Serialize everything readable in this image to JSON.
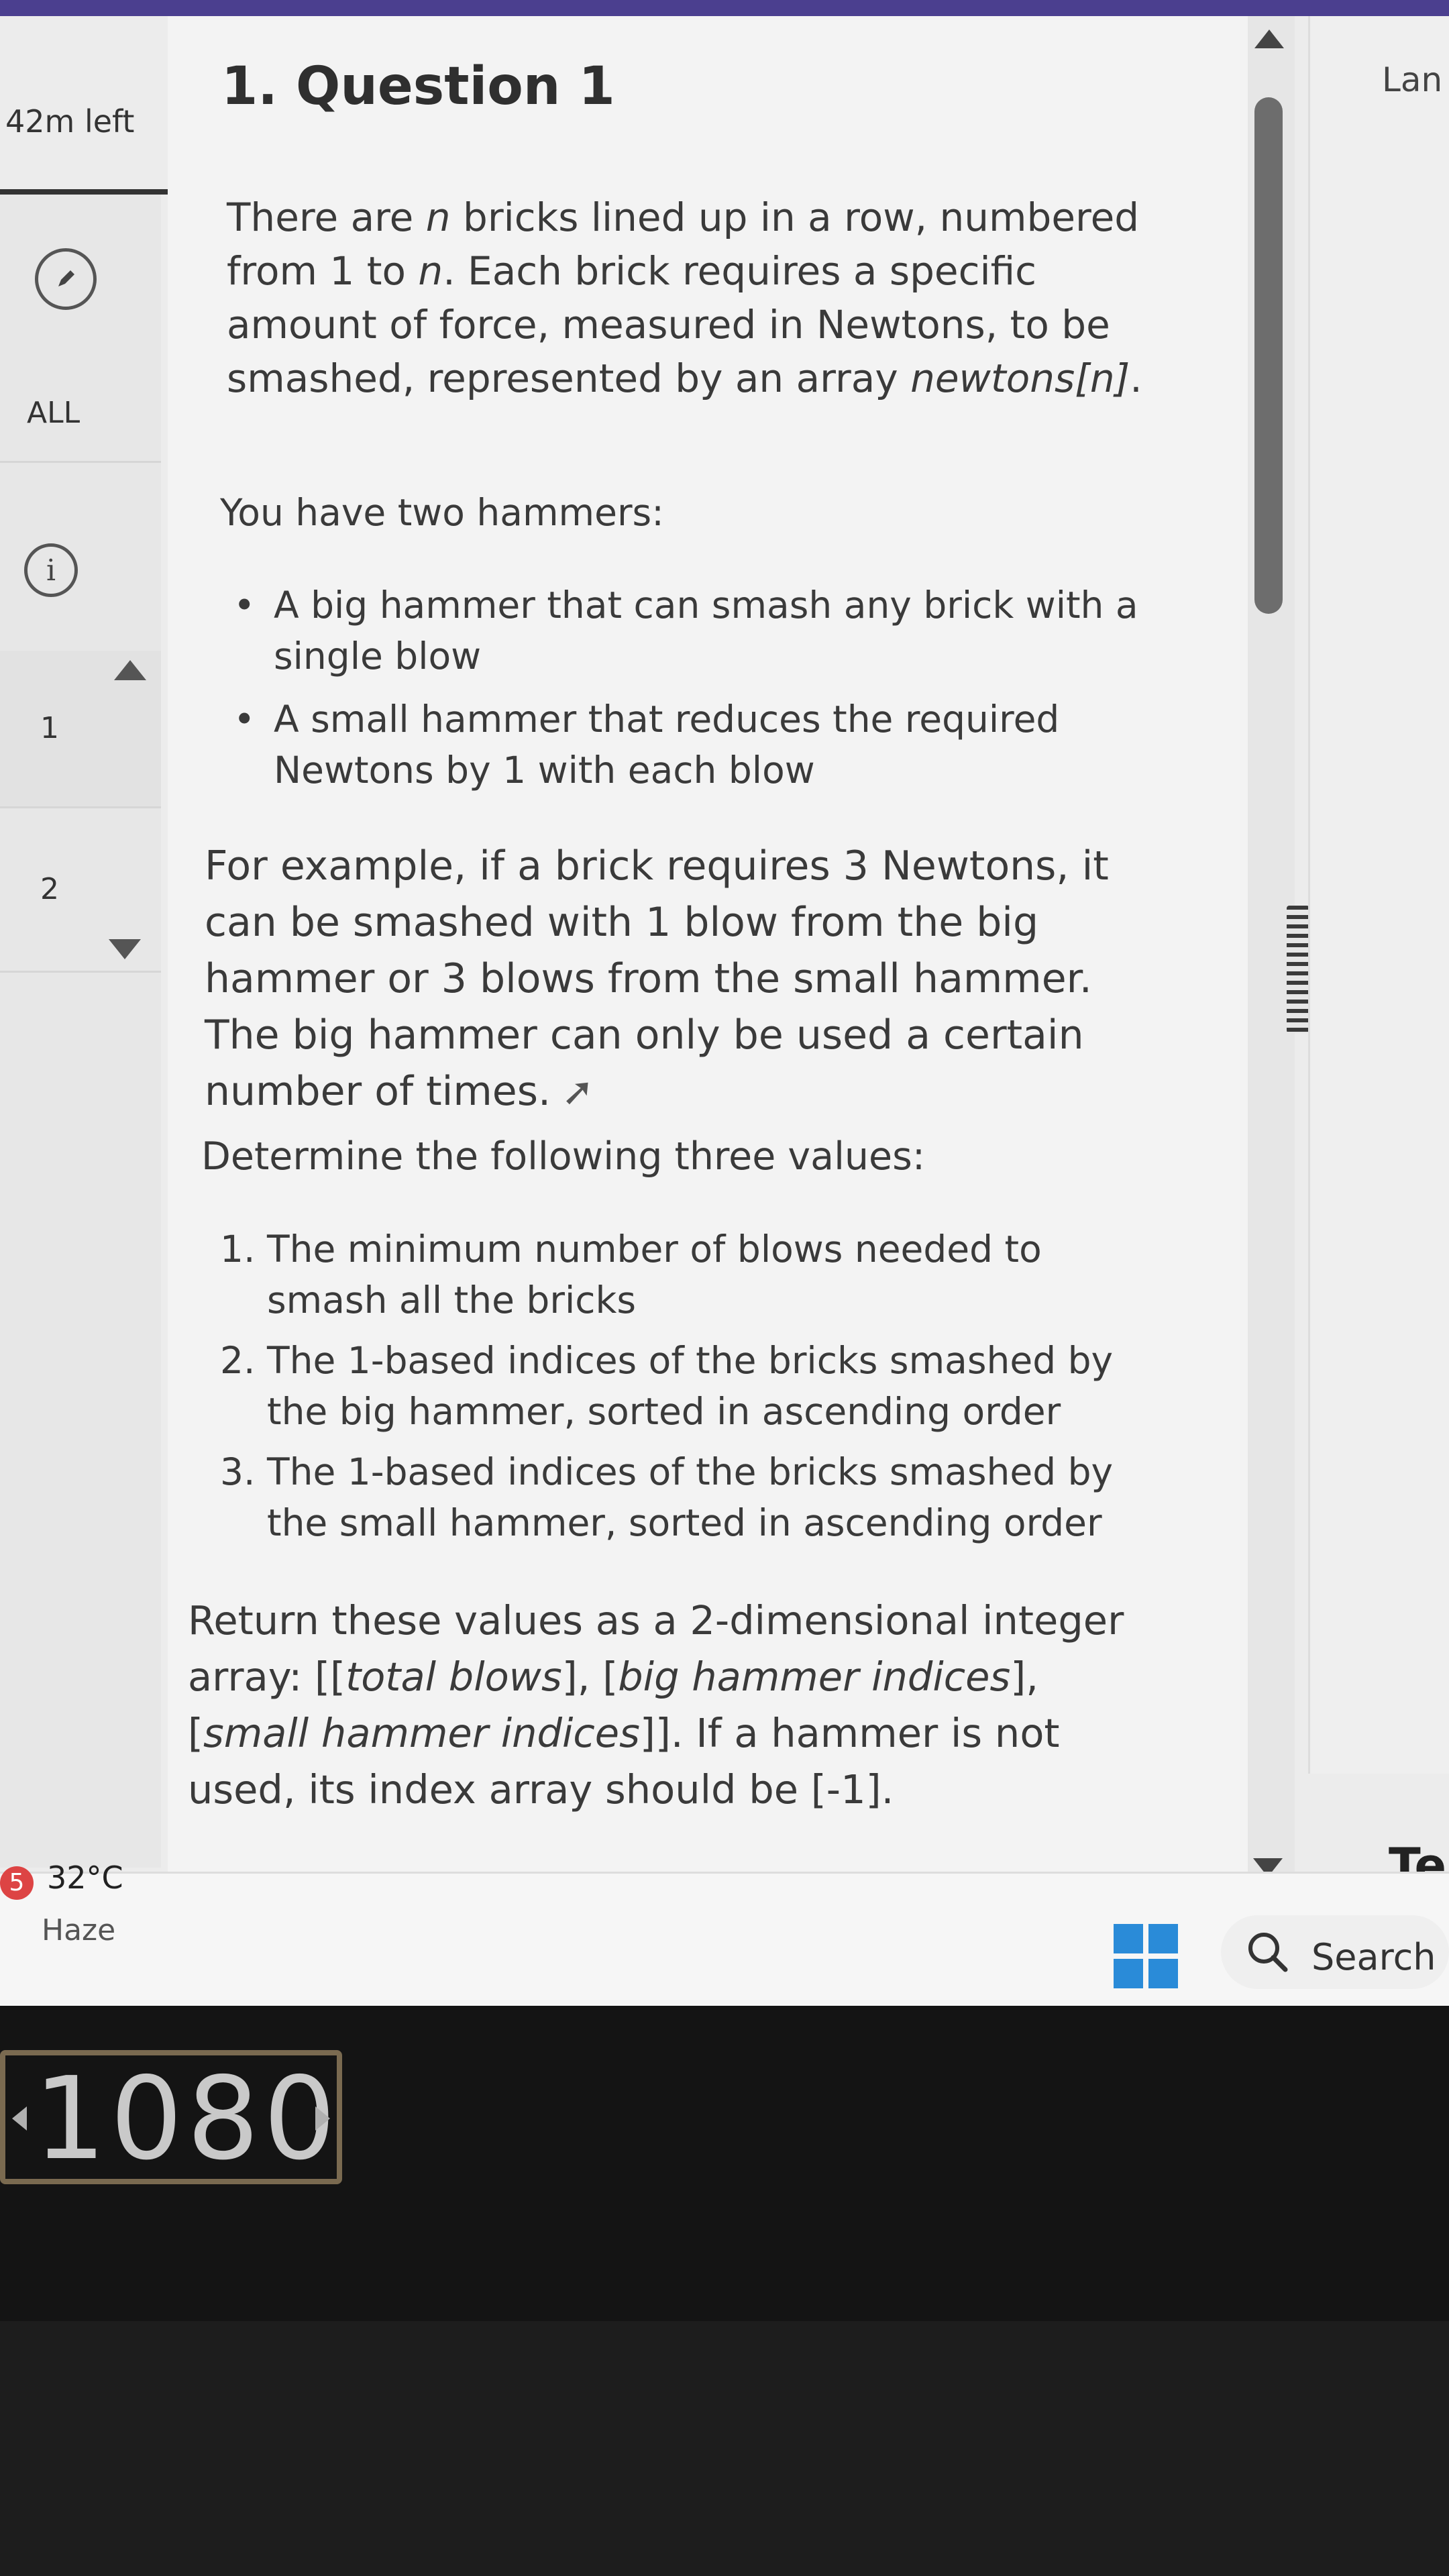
{
  "timer": {
    "label": "42m left"
  },
  "sidebar": {
    "all_label": "ALL",
    "q1_label": "1",
    "q2_label": "2"
  },
  "question": {
    "title": "1. Question 1",
    "intro_parts": [
      "There are ",
      "n",
      " bricks lined up in a row, numbered from 1 to ",
      "n",
      ". Each brick requires a specific amount of force, measured in Newtons, to be smashed, represented by an array ",
      "newtons[n]",
      "."
    ],
    "hammers_intro": "You have two hammers:",
    "hammers": [
      "A big hammer that can smash any brick with a single blow",
      "A small hammer that reduces the required Newtons by 1 with each blow"
    ],
    "example": "For example, if a brick requires 3 Newtons, it can be smashed with 1 blow from the big hammer or 3 blows from the small hammer. The big hammer can only be used a certain number of times.",
    "determine": "Determine the following three values:",
    "values": [
      {
        "num": "1.",
        "text": "The minimum number of blows needed to smash all the bricks"
      },
      {
        "num": "2.",
        "text": "The 1-based indices of the bricks smashed by the big hammer, sorted in ascending order"
      },
      {
        "num": "3.",
        "text": "The 1-based indices of the bricks smashed by the small hammer, sorted in ascending order"
      }
    ],
    "return_parts": [
      "Return these values as a 2-dimensional integer array: [[",
      "total blows",
      "], [",
      "big hammer indices",
      "], [",
      "small hammer indices",
      "]]. If a hammer is not used, its index array should be [-1]."
    ]
  },
  "right_panel": {
    "top_label": "Lan",
    "bottom_label": "Te"
  },
  "taskbar": {
    "badge": "5",
    "temperature": "32°C",
    "condition": "Haze",
    "search_label": "Search"
  },
  "monitor_osd": {
    "value": "1080"
  },
  "colors": {
    "accent_bar": "#4b3f8f",
    "windows_blue": "#2a8bd8",
    "badge_red": "#d44444"
  },
  "icons": [
    "edit-circle-icon",
    "info-icon",
    "scroll-up-icon",
    "scroll-down-icon",
    "cursor-icon",
    "windows-logo-icon",
    "search-icon"
  ]
}
